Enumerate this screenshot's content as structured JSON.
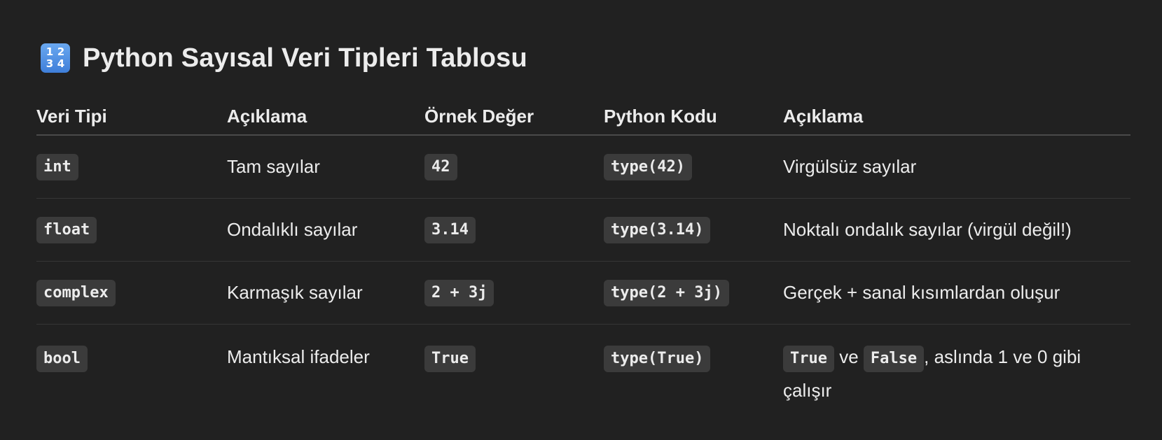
{
  "heading": {
    "icon": "input-numbers-icon",
    "icon_glyphs": [
      "1",
      "2",
      "3",
      "4"
    ],
    "title": "Python Sayısal Veri Tipleri Tablosu"
  },
  "table": {
    "headers": [
      "Veri Tipi",
      "Açıklama",
      "Örnek Değer",
      "Python Kodu",
      "Açıklama"
    ],
    "rows": [
      {
        "type": "int",
        "description": "Tam sayılar",
        "example": "42",
        "code": "type(42)",
        "note": "Virgülsüz sayılar"
      },
      {
        "type": "float",
        "description": "Ondalıklı sayılar",
        "example": "3.14",
        "code": "type(3.14)",
        "note": "Noktalı ondalık sayılar (virgül değil!)"
      },
      {
        "type": "complex",
        "description": "Karmaşık sayılar",
        "example": "2 + 3j",
        "code": "type(2 + 3j)",
        "note": "Gerçek + sanal kısımlardan oluşur"
      },
      {
        "type": "bool",
        "description": "Mantıksal ifadeler",
        "example": "True",
        "code": "type(True)",
        "note_parts": {
          "code1": "True",
          "text1": " ve ",
          "code2": "False",
          "text2": ", aslında 1 ve 0 gibi çalışır"
        }
      }
    ]
  },
  "colors": {
    "background": "#212121",
    "text": "#ececec",
    "code_bg": "#3b3b3b",
    "divider": "#363636",
    "header_divider": "#4a4a4a",
    "icon_blue": "#4f8fe6"
  }
}
